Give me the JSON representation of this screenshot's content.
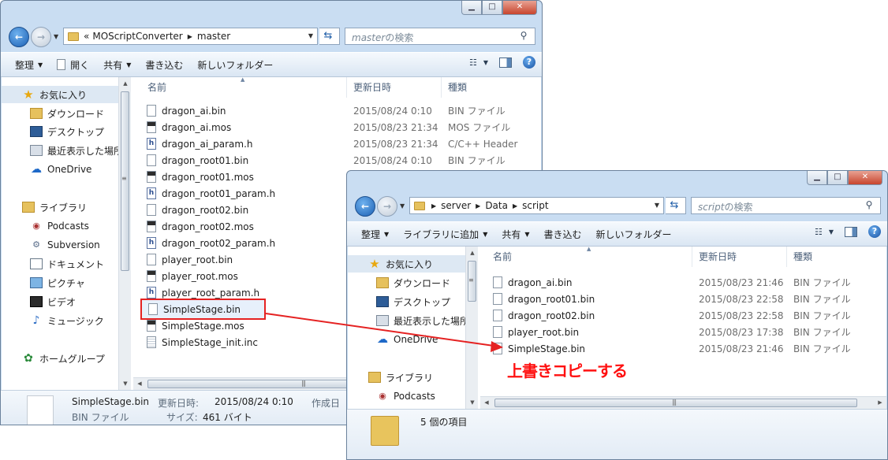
{
  "back_window": {
    "address": {
      "prefix": "«",
      "crumbs": [
        "MOScriptConverter",
        "master"
      ]
    },
    "search_placeholder": "masterの検索",
    "search_italic": "master",
    "search_suffix": "の検索",
    "toolbar": {
      "organize": "整理",
      "open": "開く",
      "share": "共有",
      "burn": "書き込む",
      "new_folder": "新しいフォルダー"
    },
    "nav": {
      "favorites": "お気に入り",
      "downloads": "ダウンロード",
      "desktop": "デスクトップ",
      "recent": "最近表示した場所",
      "onedrive": "OneDrive",
      "libraries": "ライブラリ",
      "podcasts": "Podcasts",
      "subversion": "Subversion",
      "documents": "ドキュメント",
      "pictures": "ピクチャ",
      "videos": "ビデオ",
      "music": "ミュージック",
      "homegroup": "ホームグループ"
    },
    "columns": {
      "name": "名前",
      "date": "更新日時",
      "type": "種類"
    },
    "files": [
      {
        "name": "dragon_ai.bin",
        "date": "2015/08/24 0:10",
        "type": "BIN ファイル",
        "icon": "bin"
      },
      {
        "name": "dragon_ai.mos",
        "date": "2015/08/23 21:34",
        "type": "MOS ファイル",
        "icon": "mos"
      },
      {
        "name": "dragon_ai_param.h",
        "date": "2015/08/23 21:34",
        "type": "C/C++ Header",
        "icon": "h"
      },
      {
        "name": "dragon_root01.bin",
        "date": "2015/08/24 0:10",
        "type": "BIN ファイル",
        "icon": "bin"
      },
      {
        "name": "dragon_root01.mos",
        "icon": "mos"
      },
      {
        "name": "dragon_root01_param.h",
        "icon": "h"
      },
      {
        "name": "dragon_root02.bin",
        "icon": "bin"
      },
      {
        "name": "dragon_root02.mos",
        "icon": "mos"
      },
      {
        "name": "dragon_root02_param.h",
        "icon": "h"
      },
      {
        "name": "player_root.bin",
        "icon": "bin"
      },
      {
        "name": "player_root.mos",
        "icon": "mos"
      },
      {
        "name": "player_root_param.h",
        "icon": "h"
      },
      {
        "name": "SimpleStage.bin",
        "icon": "bin",
        "selected": true
      },
      {
        "name": "SimpleStage.mos",
        "icon": "mos"
      },
      {
        "name": "SimpleStage_init.inc",
        "icon": "inc"
      }
    ],
    "status": {
      "filename": "SimpleStage.bin",
      "modified_label": "更新日時:",
      "modified_value": "2015/08/24 0:10",
      "created_label": "作成日",
      "type": "BIN ファイル",
      "size_label": "サイズ:",
      "size_value": "461 バイト"
    }
  },
  "front_window": {
    "address": {
      "crumbs": [
        "server",
        "Data",
        "script"
      ]
    },
    "search_italic": "script",
    "search_suffix": "の検索",
    "toolbar": {
      "organize": "整理",
      "add_library": "ライブラリに追加",
      "share": "共有",
      "burn": "書き込む",
      "new_folder": "新しいフォルダー"
    },
    "nav": {
      "favorites": "お気に入り",
      "downloads": "ダウンロード",
      "desktop": "デスクトップ",
      "recent": "最近表示した場所",
      "onedrive": "OneDrive",
      "libraries": "ライブラリ",
      "podcasts": "Podcasts"
    },
    "columns": {
      "name": "名前",
      "date": "更新日時",
      "type": "種類"
    },
    "files": [
      {
        "name": "dragon_ai.bin",
        "date": "2015/08/23 21:46",
        "type": "BIN ファイル"
      },
      {
        "name": "dragon_root01.bin",
        "date": "2015/08/23 22:58",
        "type": "BIN ファイル"
      },
      {
        "name": "dragon_root02.bin",
        "date": "2015/08/23 22:58",
        "type": "BIN ファイル"
      },
      {
        "name": "player_root.bin",
        "date": "2015/08/23 17:38",
        "type": "BIN ファイル"
      },
      {
        "name": "SimpleStage.bin",
        "date": "2015/08/23 21:46",
        "type": "BIN ファイル"
      }
    ],
    "status": {
      "item_count": "5 個の項目"
    }
  },
  "annotation": {
    "text": "上書きコピーする",
    "color": "#ff1010"
  },
  "colors": {
    "frame": "#c9ddf2",
    "toolbar": "#dae6f3",
    "highlight": "#e52222",
    "accent": "#1b5fb3"
  }
}
